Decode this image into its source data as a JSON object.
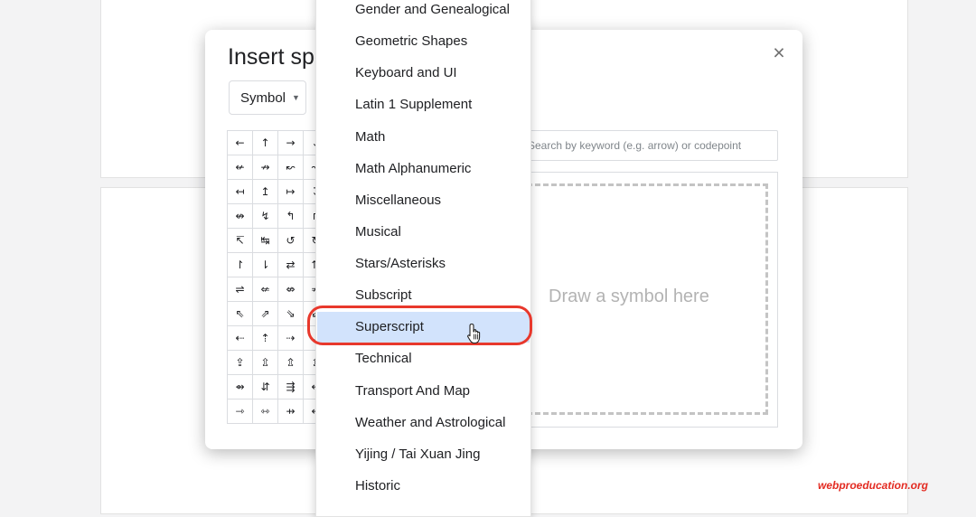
{
  "dialog": {
    "title": "Insert special characters",
    "close_glyph": "×",
    "category_value": "Symbol",
    "search_placeholder": "Search by keyword (e.g. arrow) or codepoint",
    "draw_placeholder": "Draw a symbol here"
  },
  "symbols": [
    [
      "←",
      "↑",
      "→",
      "↓"
    ],
    [
      "↚",
      "↛",
      "↜",
      "↝"
    ],
    [
      "↤",
      "↥",
      "↦",
      "↧"
    ],
    [
      "↮",
      "↯",
      "↰",
      "↱"
    ],
    [
      "↸",
      "↹",
      "↺",
      "↻"
    ],
    [
      "↾",
      "⇂",
      "⇄",
      "⇅"
    ],
    [
      "⇌",
      "⇍",
      "⇎",
      "⇏"
    ],
    [
      "⇖",
      "⇗",
      "⇘",
      "⇙"
    ],
    [
      "⇠",
      "⇡",
      "⇢",
      "⇣"
    ],
    [
      "⇪",
      "⇫",
      "⇬",
      "⇭"
    ],
    [
      "⇴",
      "⇵",
      "⇶",
      "⇷"
    ],
    [
      "⇾",
      "⇿",
      "⇸",
      "⇹"
    ]
  ],
  "menu": {
    "items": [
      "Gender and Genealogical",
      "Geometric Shapes",
      "Keyboard and UI",
      "Latin 1 Supplement",
      "Math",
      "Math Alphanumeric",
      "Miscellaneous",
      "Musical",
      "Stars/Asterisks",
      "Subscript",
      "Superscript",
      "Technical",
      "Transport And Map",
      "Weather and Astrological",
      "Yijing / Tai Xuan Jing",
      "Historic"
    ],
    "selected": "Superscript"
  },
  "colors": {
    "highlight_ring": "#e8382c",
    "selected_item_bg": "#d2e3fc",
    "watermark": "#e32b22"
  },
  "icons": {
    "close": "close-icon",
    "caret": "caret-down-icon",
    "cursor": "hand-pointer-cursor-icon"
  },
  "watermark": "webproeducation.org"
}
